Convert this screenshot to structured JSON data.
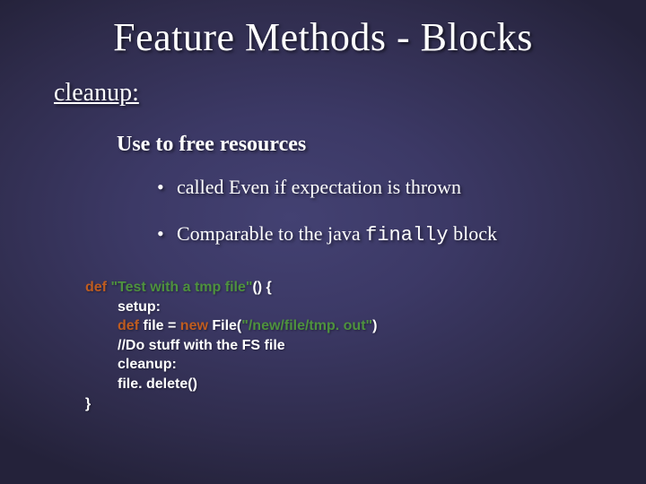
{
  "title": "Feature Methods - Blocks",
  "subtitle": "cleanup:",
  "leadline": "Use to free resources",
  "bullets": [
    {
      "dot": "•",
      "text_a": "called Even if expectation is thrown",
      "text_b": "",
      "code": ""
    },
    {
      "dot": "•",
      "text_a": "Comparable to the java ",
      "code": "finally",
      "text_b": " block"
    }
  ],
  "code": {
    "def": "def",
    "test_name": "\"Test with a tmp file\"",
    "open": "() {",
    "setup": "setup:",
    "decl_a": "def",
    "decl_b": " file = ",
    "decl_c": "new",
    "decl_d": " File(",
    "path": "\"/new/file/tmp. out\"",
    "decl_e": ")",
    "comment": "//Do stuff with the FS file",
    "cleanup": "cleanup:",
    "delete": "file. delete()",
    "close": "}"
  }
}
